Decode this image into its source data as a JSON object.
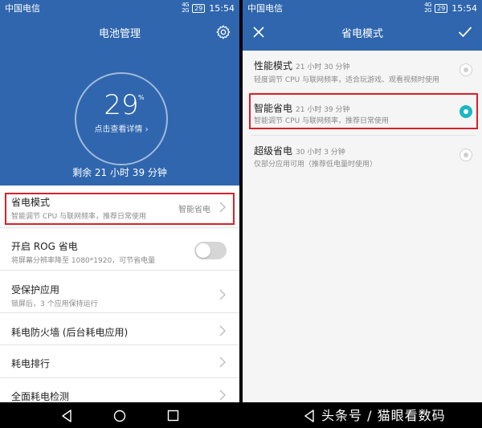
{
  "status_left": {
    "carrier": "中国电信",
    "signal_top": "4G",
    "signal_bottom": "2G",
    "battery": "29",
    "time": "15:54"
  },
  "status_right": {
    "carrier": "中国电信",
    "signal_top": "4G",
    "signal_bottom": "2G",
    "battery": "29",
    "time": "15:54"
  },
  "battery_screen": {
    "title": "电池管理",
    "percent": "29",
    "percent_sign": "%",
    "detail_link": "点击查看详情 ›",
    "remaining": "剩余 21 小时 39 分钟",
    "items": [
      {
        "title": "省电模式",
        "subtitle": "智能调节 CPU 与联网频率，推荐日常使用",
        "value": "智能省电"
      },
      {
        "title": "开启 ROG 省电",
        "subtitle": "将屏幕分辨率降至 1080*1920，可节省电量"
      },
      {
        "title": "受保护应用",
        "subtitle": "锁屏后，3 个应用保持运行"
      },
      {
        "title": "耗电防火墙 (后台耗电应用)"
      },
      {
        "title": "耗电排行"
      },
      {
        "title": "全面耗电检测"
      }
    ],
    "rog_toggle_on": false
  },
  "power_mode_screen": {
    "title": "省电模式",
    "options": [
      {
        "title": "性能模式",
        "time": "21 小时 30 分钟",
        "subtitle": "轻度调节 CPU 与联网频率，适合玩游戏、观看视频时使用",
        "selected": false
      },
      {
        "title": "智能省电",
        "time": "21 小时 39 分钟",
        "subtitle": "智能调节 CPU 与联网频率，推荐日常使用",
        "selected": true
      },
      {
        "title": "超级省电",
        "time": "30 小时 3 分钟",
        "subtitle": "仅部分应用可用（推荐低电量时使用）",
        "selected": false
      }
    ]
  },
  "watermark": "头条号 / 猫眼看数码",
  "colors": {
    "header_blue": "#2f66ae",
    "highlight_red": "#d8222b",
    "radio_teal": "#1ab6c4"
  }
}
